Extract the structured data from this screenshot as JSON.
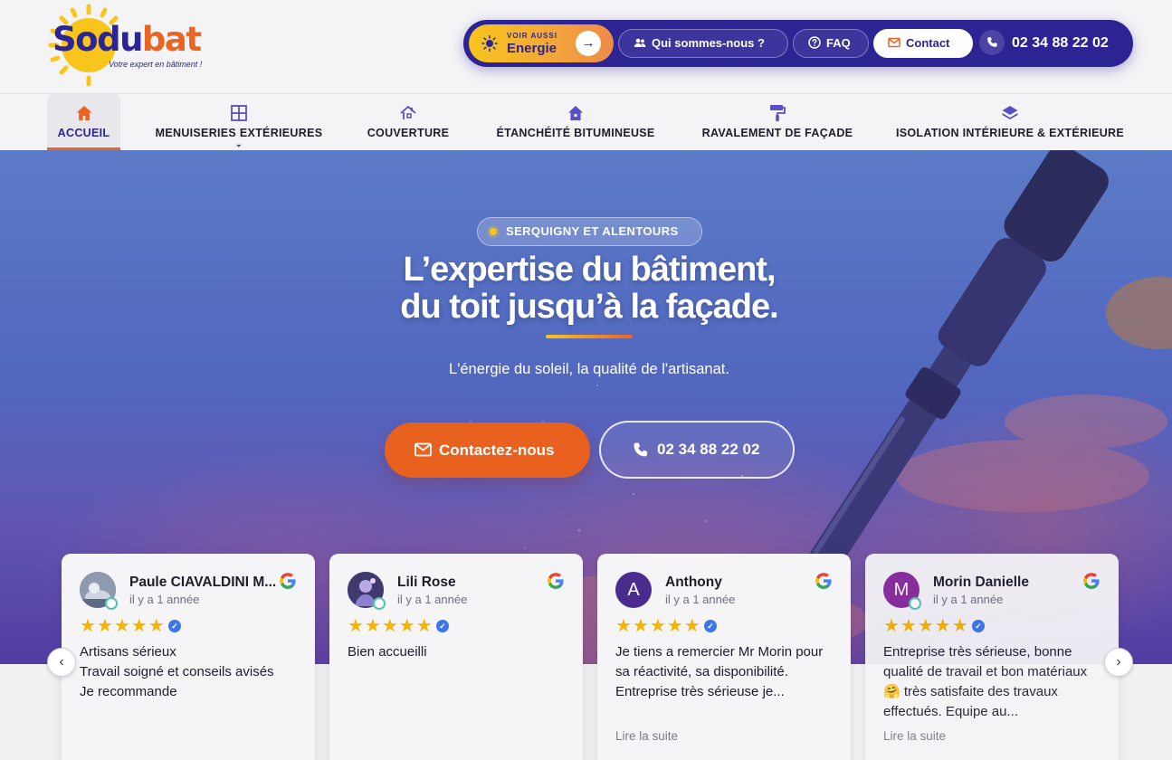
{
  "brand": {
    "logo_part1": "So",
    "logo_part2": "du",
    "logo_part3": "bat",
    "tagline": "Votre expert en bâtiment !",
    "colors": {
      "primary": "#2c2596",
      "accent": "#ea6524",
      "sun": "#f7c51c"
    }
  },
  "topbar": {
    "energy_kicker": "VOIR AUSSI",
    "energy_label": "Energie",
    "about_label": "Qui sommes-nous ?",
    "faq_label": "FAQ",
    "contact_label": "Contact",
    "phone": "02 34 88 22 02"
  },
  "nav": {
    "items": [
      {
        "label": "ACCUEIL",
        "icon": "home-icon",
        "active": true
      },
      {
        "label": "MENUISERIES EXTÉRIEURES",
        "icon": "window-icon",
        "has_dropdown": true
      },
      {
        "label": "COUVERTURE",
        "icon": "roof-icon"
      },
      {
        "label": "ÉTANCHÉITÉ BITUMINEUSE",
        "icon": "house-icon"
      },
      {
        "label": "RAVALEMENT DE FAÇADE",
        "icon": "paint-roller-icon"
      },
      {
        "label": "ISOLATION INTÉRIEURE & EXTÉRIEURE",
        "icon": "layers-icon"
      }
    ]
  },
  "hero": {
    "badge": "SERQUIGNY ET ALENTOURS",
    "title_line1": "L’expertise du bâtiment,",
    "title_line2": "du toit jusqu’à la façade.",
    "subtitle": "L'énergie du soleil, la qualité de l'artisanat.",
    "cta_contact": "Contactez-nous",
    "cta_phone": "02 34 88 22 02"
  },
  "reviews": [
    {
      "name": "Paule CIAVALDINI M...",
      "time": "il y a 1 année",
      "stars": "★★★★★",
      "rating": 5,
      "text": "Artisans sérieux\nTravail soigné et conseils avisés\nJe recommande",
      "more": "",
      "avatar_letter": "",
      "avatar_color": "#7c8aa0"
    },
    {
      "name": "Lili Rose",
      "time": "il y a 1 année",
      "stars": "★★★★★",
      "rating": 5,
      "text": "Bien accueilli",
      "more": "",
      "avatar_letter": "",
      "avatar_color": "#5b4f8f"
    },
    {
      "name": "Anthony",
      "time": "il y a 1 année",
      "stars": "★★★★★",
      "rating": 5,
      "text": "Je tiens a remercier Mr Morin pour sa réactivité, sa disponibilité.\nEntreprise très sérieuse je...",
      "more": "Lire la suite",
      "avatar_letter": "A",
      "avatar_color": "#4a2c8f"
    },
    {
      "name": "Morin Danielle",
      "time": "il y a 1 année",
      "stars": "★★★★★",
      "rating": 5,
      "text": "Entreprise très sérieuse, bonne qualité de travail et bon matériaux 🤗 très satisfaite des travaux effectués. Equipe au...",
      "more": "Lire la suite",
      "avatar_letter": "M",
      "avatar_color": "#8a2b9c"
    }
  ],
  "carousel": {
    "prev": "‹",
    "next": "›"
  }
}
